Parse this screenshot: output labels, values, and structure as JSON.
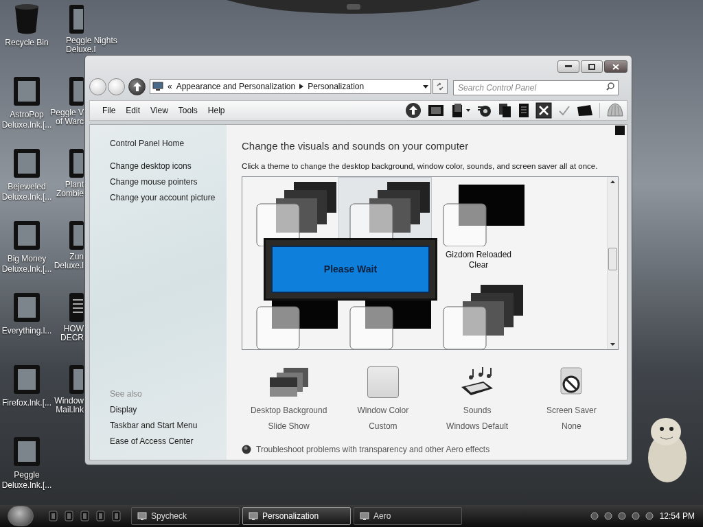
{
  "desktop_icons": [
    {
      "kind": "bin",
      "lines": [
        "Recycle Bin"
      ]
    },
    {
      "kind": "shortcut",
      "lines": [
        "AstroPop",
        "Deluxe.lnk.[..."
      ]
    },
    {
      "kind": "shortcut",
      "lines": [
        "Bejeweled",
        "Deluxe.lnk.[..."
      ]
    },
    {
      "kind": "shortcut",
      "lines": [
        "Big Money",
        "Deluxe.lnk.[..."
      ]
    },
    {
      "kind": "shortcut",
      "lines": [
        "Everything.l..."
      ]
    },
    {
      "kind": "shortcut",
      "lines": [
        "Firefox.lnk.[..."
      ]
    },
    {
      "kind": "shortcut",
      "lines": [
        "Peggle",
        "Deluxe.lnk.[..."
      ]
    }
  ],
  "desktop_icons_partial": [
    {
      "kind": "shortcut",
      "lines": [
        "Peggle Nights",
        "Deluxe.l"
      ]
    },
    {
      "kind": "shortcut",
      "lines": [
        "Peggle V",
        "of Warc"
      ]
    },
    {
      "kind": "shortcut",
      "lines": [
        "Plant",
        "Zombie"
      ]
    },
    {
      "kind": "shortcut",
      "lines": [
        "Zun",
        "Deluxe.l"
      ]
    },
    {
      "kind": "list",
      "lines": [
        "HOW",
        "DECR"
      ]
    },
    {
      "kind": "shortcut",
      "lines": [
        "Window",
        "Mail.lnk"
      ]
    }
  ],
  "window": {
    "address": {
      "prefix": "«",
      "segments": [
        "Appearance and Personalization",
        "Personalization"
      ]
    },
    "search": {
      "placeholder": "Search Control Panel"
    },
    "menu": [
      "File",
      "Edit",
      "View",
      "Tools",
      "Help"
    ],
    "sidebar": {
      "links": [
        "Control Panel Home",
        "Change desktop icons",
        "Change mouse pointers",
        "Change your account picture"
      ],
      "see_also_heading": "See also",
      "see_also": [
        "Display",
        "Taskbar and Start Menu",
        "Ease of Access Center"
      ]
    },
    "heading": "Change the visuals and sounds on your computer",
    "instruction": "Click a theme to change the desktop background, window color, sounds, and screen saver all at once.",
    "themes": [
      {
        "kind": "stack",
        "selected": false
      },
      {
        "kind": "stack",
        "selected": true
      },
      {
        "kind": "single",
        "selected": false,
        "lines": [
          "Gizdom Reloaded",
          "Clear"
        ]
      },
      {
        "kind": "single",
        "selected": false
      },
      {
        "kind": "single",
        "selected": false
      },
      {
        "kind": "stack",
        "selected": false
      }
    ],
    "overlay": {
      "text": "Please Wait"
    },
    "settings": [
      {
        "kind": "slideshow",
        "title": "Desktop Background",
        "value": "Slide Show"
      },
      {
        "kind": "color",
        "title": "Window Color",
        "value": "Custom"
      },
      {
        "kind": "sounds",
        "title": "Sounds",
        "value": "Windows Default"
      },
      {
        "kind": "screensaver",
        "title": "Screen Saver",
        "value": "None"
      }
    ],
    "troubleshoot": "Troubleshoot problems with transparency and other Aero effects"
  },
  "taskbar": {
    "tasks": [
      {
        "label": "Spycheck",
        "selected": false
      },
      {
        "label": "Personalization",
        "selected": true
      },
      {
        "label": "Aero",
        "selected": false
      }
    ],
    "clock": "12:54 PM"
  }
}
